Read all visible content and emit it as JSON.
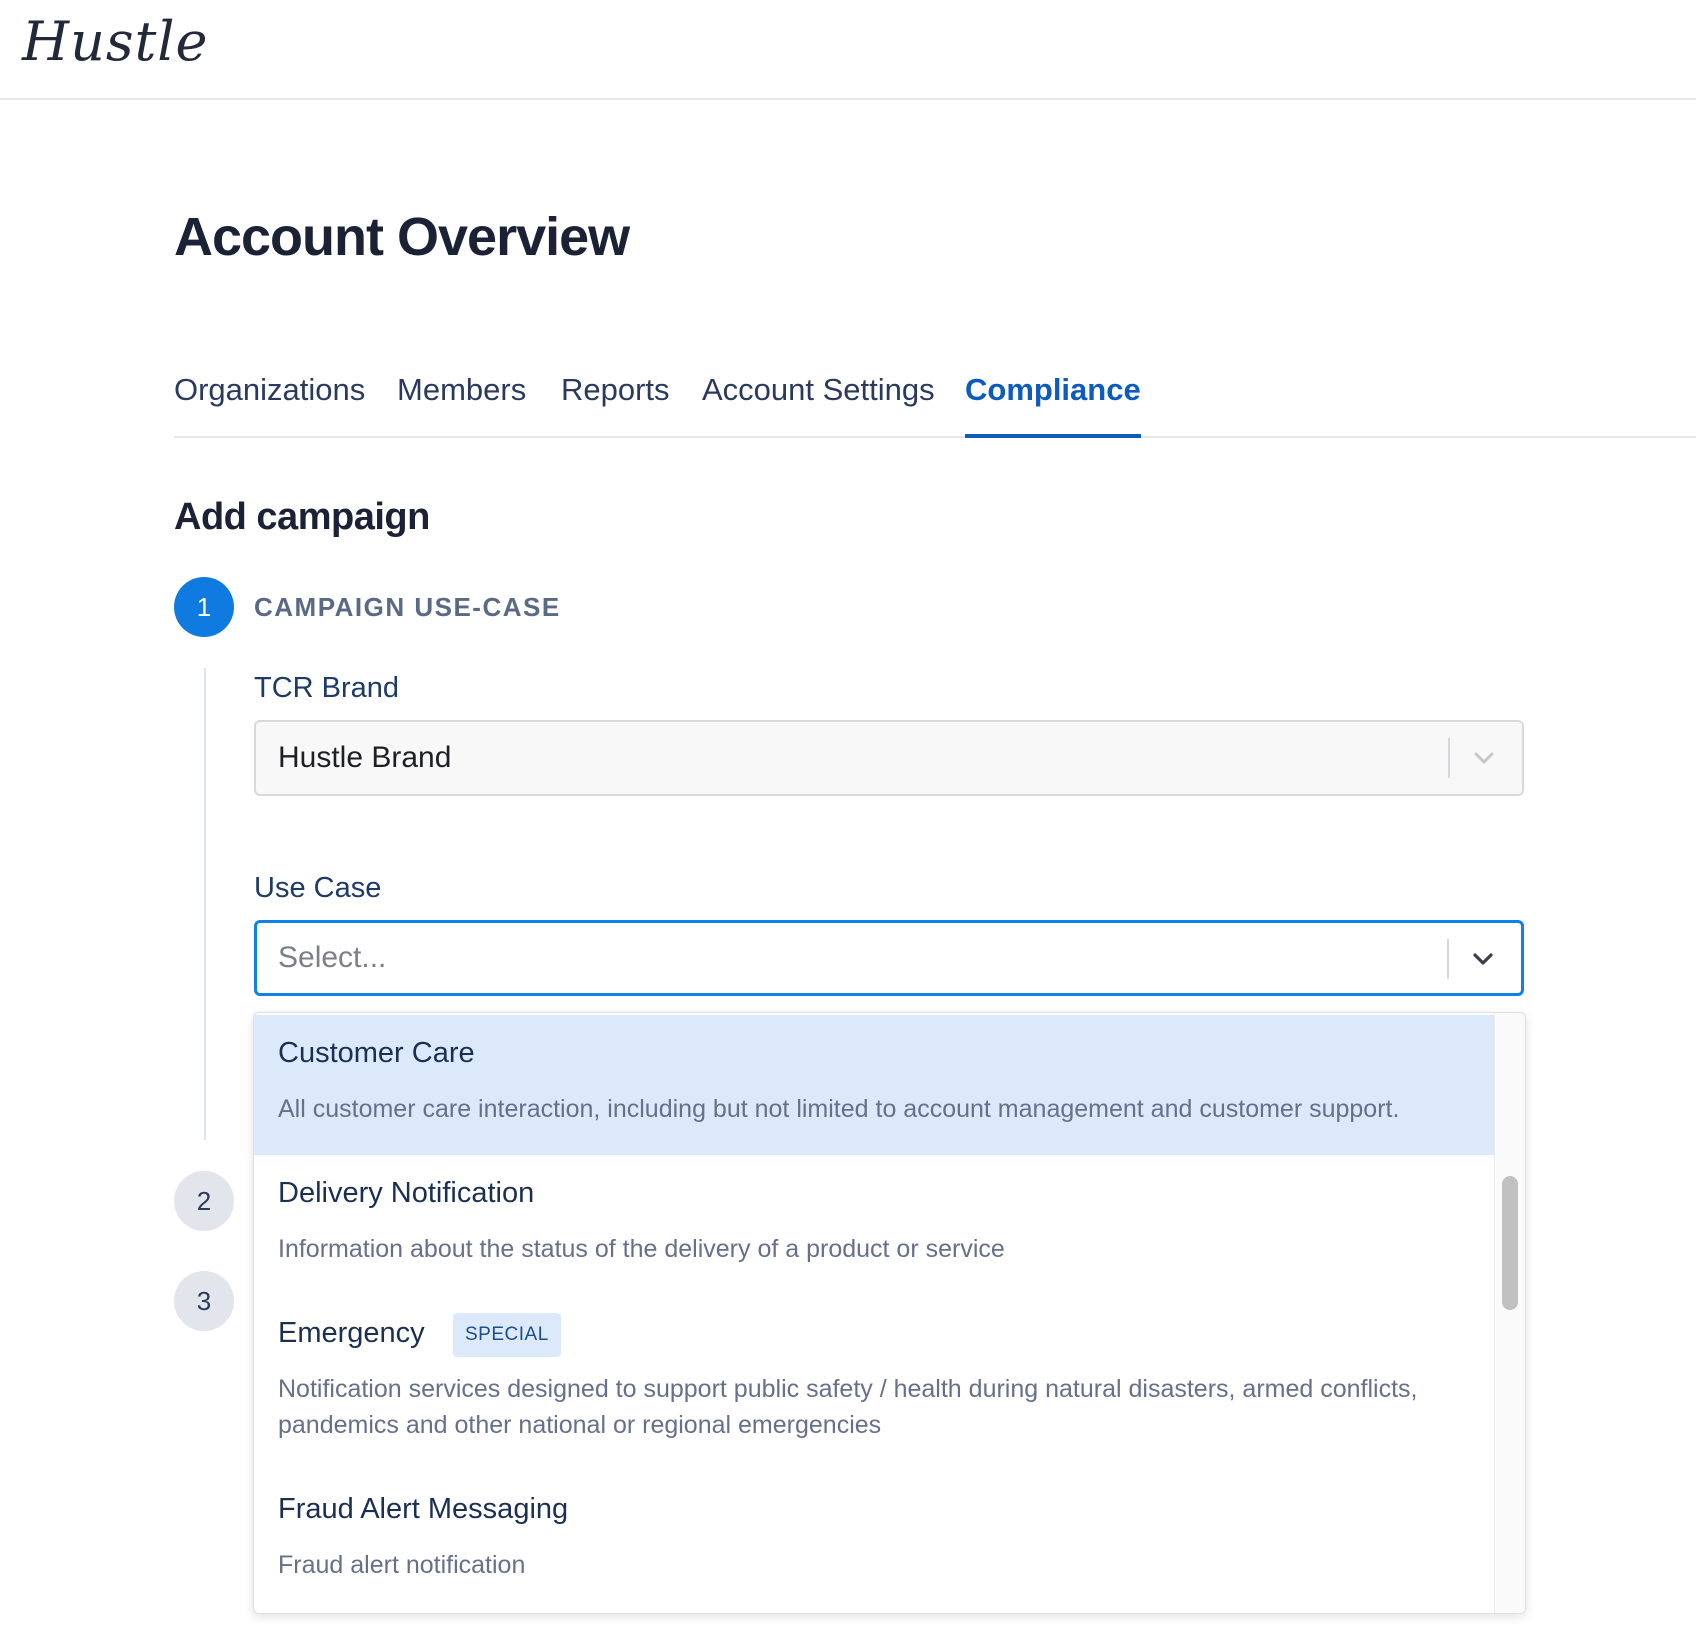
{
  "app": {
    "logo": "Hustle"
  },
  "page": {
    "title": "Account Overview"
  },
  "tabs": [
    {
      "label": "Organizations",
      "active": false
    },
    {
      "label": "Members",
      "active": false
    },
    {
      "label": "Reports",
      "active": false
    },
    {
      "label": "Account Settings",
      "active": false
    },
    {
      "label": "Compliance",
      "active": true
    }
  ],
  "section": {
    "title": "Add campaign"
  },
  "steps": [
    {
      "number": "1",
      "label": "CAMPAIGN USE-CASE",
      "state": "active"
    },
    {
      "number": "2",
      "state": "inactive"
    },
    {
      "number": "3",
      "state": "inactive"
    }
  ],
  "form": {
    "tcr_brand": {
      "label": "TCR Brand",
      "value": "Hustle Brand"
    },
    "use_case": {
      "label": "Use Case",
      "placeholder": "Select..."
    }
  },
  "dropdown": {
    "options": [
      {
        "title": "Customer Care",
        "description": "All customer care interaction, including but not limited to account management and customer support.",
        "badge": ""
      },
      {
        "title": "Delivery Notification",
        "description": "Information about the status of the delivery of a product or service",
        "badge": ""
      },
      {
        "title": "Emergency",
        "description": "Notification services designed to support public safety / health during natural disasters, armed conflicts, pandemics and other national or regional emergencies",
        "badge": "SPECIAL"
      },
      {
        "title": "Fraud Alert Messaging",
        "description": "Fraud alert notification",
        "badge": ""
      }
    ]
  },
  "colors": {
    "accent": "#0f7ae0",
    "active_tab": "#0d5bbd",
    "highlight": "#dce9fa"
  }
}
